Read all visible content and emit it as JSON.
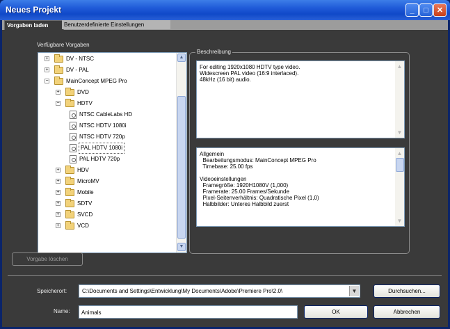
{
  "window": {
    "title": "Neues Projekt",
    "controls": [
      "minimize-icon",
      "maximize-icon",
      "close-icon"
    ]
  },
  "tabs": [
    {
      "label": "Vorgaben laden",
      "active": true
    },
    {
      "label": "Benutzerdefinierte Einstellungen",
      "active": false
    }
  ],
  "presets": {
    "label": "Verfügbare Vorgaben",
    "tree": [
      {
        "label": "DV - NTSC",
        "type": "folder",
        "depth": 0,
        "toggle": "+"
      },
      {
        "label": "DV - PAL",
        "type": "folder",
        "depth": 0,
        "toggle": "+"
      },
      {
        "label": "MainConcept MPEG Pro",
        "type": "folder",
        "depth": 0,
        "toggle": "−"
      },
      {
        "label": "DVD",
        "type": "folder",
        "depth": 1,
        "toggle": "+"
      },
      {
        "label": "HDTV",
        "type": "folder",
        "depth": 1,
        "toggle": "−"
      },
      {
        "label": "NTSC CableLabs HD",
        "type": "file",
        "depth": 2
      },
      {
        "label": "NTSC HDTV 1080i",
        "type": "file",
        "depth": 2
      },
      {
        "label": "NTSC HDTV 720p",
        "type": "file",
        "depth": 2
      },
      {
        "label": "PAL HDTV 1080i",
        "type": "file",
        "depth": 2,
        "selected": true
      },
      {
        "label": "PAL HDTV 720p",
        "type": "file",
        "depth": 2
      },
      {
        "label": "HDV",
        "type": "folder",
        "depth": 1,
        "toggle": "+"
      },
      {
        "label": "MicroMV",
        "type": "folder",
        "depth": 1,
        "toggle": "+"
      },
      {
        "label": "Mobile",
        "type": "folder",
        "depth": 1,
        "toggle": "+"
      },
      {
        "label": "SDTV",
        "type": "folder",
        "depth": 1,
        "toggle": "+"
      },
      {
        "label": "SVCD",
        "type": "folder",
        "depth": 1,
        "toggle": "+"
      },
      {
        "label": "VCD",
        "type": "folder",
        "depth": 1,
        "toggle": "+"
      }
    ]
  },
  "description": {
    "title": "Beschreibung",
    "lines": [
      "For editing 1920x1080 HDTV type video.",
      "Widescreen PAL video (16:9 interlaced).",
      "48kHz (16 bit) audio."
    ]
  },
  "details": {
    "lines": [
      "Allgemein",
      "  Bearbeitungsmodus: MainConcept MPEG Pro",
      "  Timebase: 25.00 fps",
      "",
      "Videoeinstellungen",
      "  Framegröße: 1920H1080V (1,000)",
      "  Framerate: 25.00 Frames/Sekunde",
      "  Pixel-Seitenverhältnis: Quadratische Pixel (1,0)",
      "  Halbbilder: Unteres Halbbild zuerst"
    ]
  },
  "buttons": {
    "delete_preset": "Vorgabe löschen",
    "browse": "Durchsuchen...",
    "ok": "OK",
    "cancel": "Abbrechen"
  },
  "location": {
    "label": "Speicherort:",
    "value": "C:\\Documents and Settings\\Entwicklung\\My Documents\\Adobe\\Premiere Pro\\2.0\\"
  },
  "name": {
    "label": "Name:",
    "value": "Animals"
  }
}
